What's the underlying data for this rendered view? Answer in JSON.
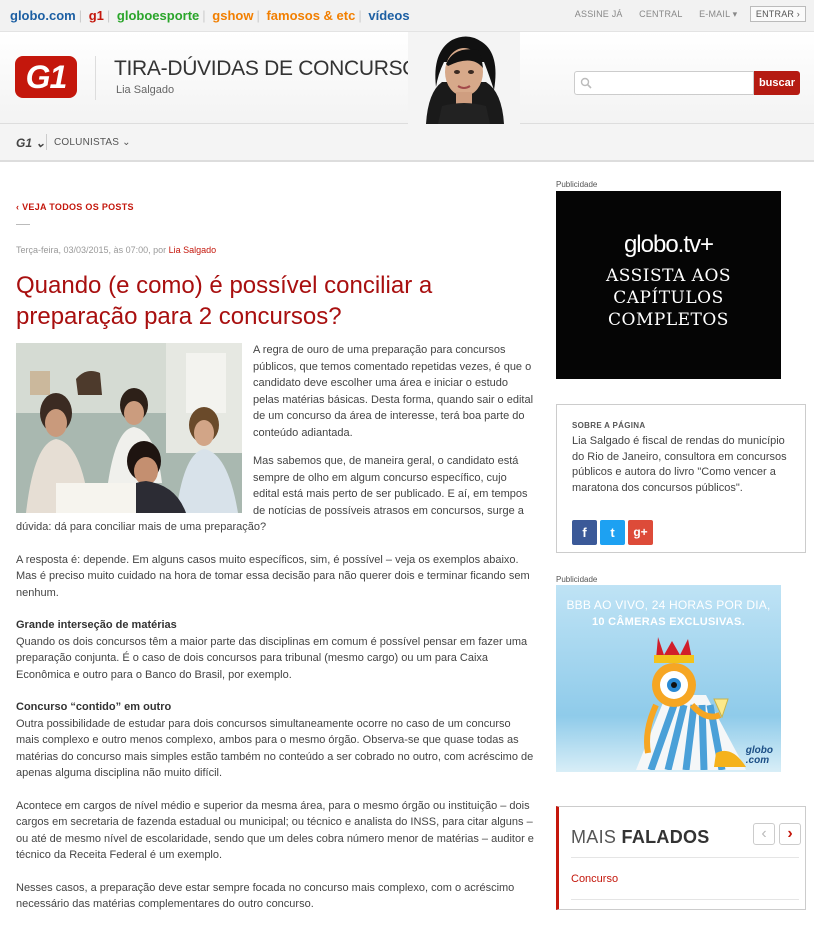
{
  "globobar": {
    "links": [
      "globo.com",
      "g1",
      "globoesporte",
      "gshow",
      "famosos & etc",
      "vídeos"
    ],
    "right": [
      "ASSINE JÁ",
      "CENTRAL",
      "E-MAIL ▾",
      "ENTRAR ›"
    ]
  },
  "header": {
    "logo": "G1",
    "title": "TIRA-DÚVIDAS DE CONCURSOS",
    "author": "Lia Salgado",
    "search_placeholder": "",
    "search_button": "buscar"
  },
  "nav": {
    "g1": "G1 ⌄",
    "columnists": "COLUNISTAS ⌄"
  },
  "post": {
    "back": "‹ VEJA TODOS OS POSTS",
    "meta_prefix": "Terça-feira, 03/03/2015, às 07:00, por ",
    "meta_author": "Lia Salgado",
    "title": "Quando (e como) é possível conciliar a preparação para 2 concursos?",
    "p1": "A regra de ouro de uma preparação para concursos públicos, que temos comentado repetidas vezes, é que o candidato deve escolher uma área e iniciar o estudo pelas matérias básicas. Desta forma, quando sair o edital de um concurso da área de interesse, terá boa parte do conteúdo adiantada.",
    "p2": "Mas sabemos que, de maneira geral, o candidato está sempre de olho em algum concurso específico, cujo edital está mais perto de ser publicado. E aí, em tempos de notícias de possíveis atrasos em concursos, surge a dúvida: dá para conciliar mais de uma preparação?",
    "p3": "A resposta é: depende. Em alguns casos muito específicos, sim, é possível – veja os exemplos abaixo. Mas é preciso muito cuidado na hora de tomar essa decisão para não querer dois e terminar ficando sem nenhum.",
    "h4": "Grande interseção de matérias",
    "p4": "Quando os dois concursos têm a maior parte das disciplinas em comum é possível pensar em fazer uma preparação conjunta. É o caso de dois concursos para tribunal (mesmo cargo) ou um para Caixa Econômica e outro para o Banco do Brasil, por exemplo.",
    "h5": "Concurso “contido” em outro",
    "p5": "Outra possibilidade de estudar para dois concursos simultaneamente ocorre no caso de um concurso mais complexo e outro menos complexo, ambos para o mesmo órgão. Observa-se que quase todas as matérias do concurso mais simples estão também no conteúdo a ser cobrado no outro, com acréscimo de apenas alguma disciplina não muito difícil.",
    "p6": "Acontece em cargos de nível médio e superior da mesma área, para o mesmo órgão ou instituição – dois cargos em secretaria de fazenda estadual ou municipal; ou técnico e analista do INSS, para citar alguns – ou até de mesmo nível de escolaridade, sendo que um deles cobra número menor de matérias – auditor e técnico da Receita Federal é um exemplo.",
    "p7": "Nesses casos, a preparação deve estar sempre focada no concurso mais complexo, com o acréscimo necessário das matérias complementares do outro concurso."
  },
  "sidebar": {
    "pub_label": "Publicidade",
    "ad1_brand": "globo.tv+",
    "ad1_line1": "ASSISTA AOS",
    "ad1_line2": "CAPÍTULOS",
    "ad1_line3": "COMPLETOS",
    "about_title": "SOBRE A PÁGINA",
    "about_text": "Lia Salgado é fiscal de rendas do município do Rio de Janeiro, consultora em concursos públicos e autora do livro \"Como vencer a maratona dos concursos públicos\".",
    "social": [
      "f",
      "t",
      "g+"
    ],
    "ad2_line1": "BBB AO VIVO, 24 HORAS POR DIA,",
    "ad2_line2": "10 CÂMERAS EXCLUSIVAS.",
    "ad2_brand1": "globo",
    "ad2_brand2": ".com",
    "mais_prefix": "MAIS ",
    "mais_bold": "FALADOS",
    "mais_item": "Concurso"
  },
  "colors": {
    "g1_red": "#c4170c",
    "headline": "#a80f0f",
    "facebook": "#3b5998",
    "twitter": "#1da1f2",
    "gplus": "#dd4b39"
  }
}
